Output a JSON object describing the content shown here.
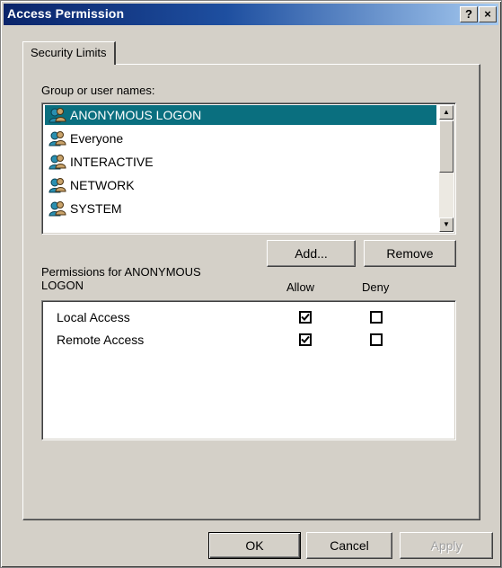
{
  "window": {
    "title": "Access Permission",
    "help_glyph": "?",
    "close_glyph": "×"
  },
  "tabs": [
    {
      "label": "Security Limits",
      "active": true
    }
  ],
  "users": {
    "label": "Group or user names:",
    "items": [
      {
        "name": "ANONYMOUS LOGON",
        "icon": "user-group-icon",
        "selected": true
      },
      {
        "name": "Everyone",
        "icon": "user-group-icon",
        "selected": false
      },
      {
        "name": "INTERACTIVE",
        "icon": "user-group-icon",
        "selected": false
      },
      {
        "name": "NETWORK",
        "icon": "user-group-icon",
        "selected": false
      },
      {
        "name": "SYSTEM",
        "icon": "user-group-icon",
        "selected": false
      }
    ],
    "scroll_up_glyph": "▲",
    "scroll_down_glyph": "▼"
  },
  "buttons": {
    "add": "Add...",
    "remove": "Remove",
    "ok": "OK",
    "cancel": "Cancel",
    "apply": "Apply"
  },
  "permissions": {
    "header_line1": "Permissions for ANONYMOUS",
    "header_line2": "LOGON",
    "allow_label": "Allow",
    "deny_label": "Deny",
    "rows": [
      {
        "name": "Local Access",
        "allow": true,
        "deny": false
      },
      {
        "name": "Remote Access",
        "allow": true,
        "deny": false
      }
    ]
  },
  "colors": {
    "selection": "#0a6f7f",
    "title_start": "#0a246a",
    "title_end": "#a6caf0",
    "face": "#d4d0c8"
  }
}
